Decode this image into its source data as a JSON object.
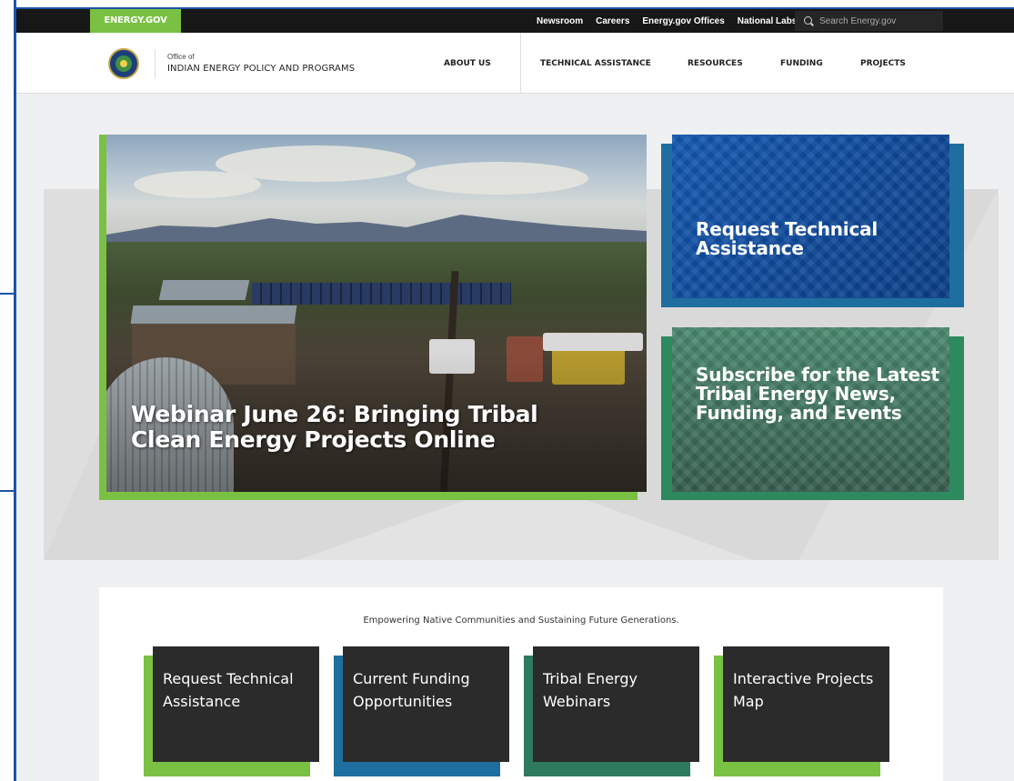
{
  "utility_bar": {
    "brand": "ENERGY.GOV",
    "links": [
      "Newsroom",
      "Careers",
      "Energy.gov Offices",
      "National Labs"
    ],
    "search_placeholder": "Search Energy.gov"
  },
  "header": {
    "office_prefix": "Office of",
    "office_name": "INDIAN ENERGY POLICY AND PROGRAMS",
    "nav": [
      "ABOUT US",
      "TECHNICAL ASSISTANCE",
      "RESOURCES",
      "FUNDING",
      "PROJECTS"
    ]
  },
  "hero": {
    "feature_title": "Webinar June 26: Bringing Tribal Clean Energy Projects Online",
    "cards": [
      {
        "label": "Request Technical Assistance"
      },
      {
        "label": "Subscribe for the Latest Tribal Energy News, Funding, and Events"
      }
    ]
  },
  "bottom": {
    "tagline": "Empowering Native Communities and Sustaining Future Generations.",
    "tiles": [
      {
        "label": "Request Technical Assistance",
        "accent": "#7ac143"
      },
      {
        "label": "Current Funding Opportunities",
        "accent": "#1e6ea0"
      },
      {
        "label": "Tribal Energy Webinars",
        "accent": "#2d7a5f"
      },
      {
        "label": "Interactive Projects Map",
        "accent": "#7ac143"
      }
    ]
  },
  "colors": {
    "energy_green": "#7ac143",
    "frame_blue": "#1a55a8",
    "tile_dark": "#2b2b2b"
  }
}
